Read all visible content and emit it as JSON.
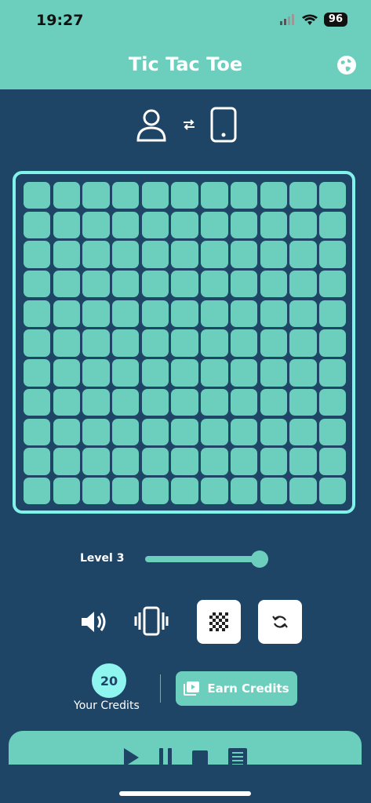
{
  "status": {
    "time": "19:27",
    "battery": "96"
  },
  "header": {
    "title": "Tic Tac Toe"
  },
  "board": {
    "size": 11
  },
  "level": {
    "label": "Level 3",
    "value": 0.93
  },
  "credits": {
    "count": "20",
    "label": "Your Credits"
  },
  "earn": {
    "label": "Earn Credits"
  },
  "colors": {
    "primary": "#6ccfbd",
    "background": "#1f4566",
    "accent": "#7ff3ea"
  },
  "icons": [
    "person-icon",
    "swap-icon",
    "phone-icon",
    "globe-icon",
    "speaker-icon",
    "vibration-icon",
    "board-icon",
    "refresh-icon",
    "play-icon",
    "pause-icon",
    "stop-icon",
    "list-icon"
  ]
}
